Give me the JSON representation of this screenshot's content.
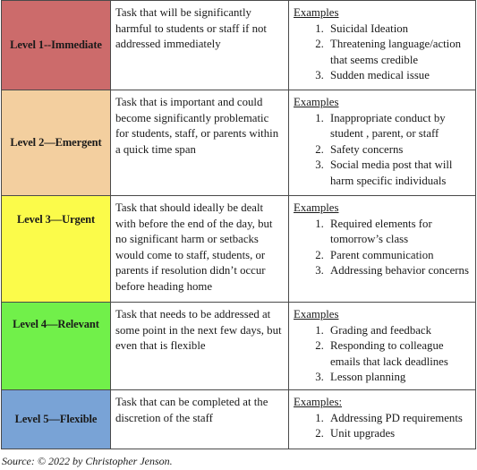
{
  "rows": [
    {
      "level": "Level 1--Immediate",
      "color": "#cc6b6b",
      "description": "Task that will be significantly harmful to students or staff if not addressed immediately",
      "examples_label": "Examples",
      "examples": [
        "Suicidal Ideation",
        "Threatening language/action that seems credible",
        "Sudden medical issue"
      ]
    },
    {
      "level": "Level 2—Emergent",
      "color": "#f3cf9f",
      "description": "Task that is important and could become significantly problematic for students, staff, or parents within a quick time span",
      "examples_label": "Examples",
      "examples": [
        "Inappropriate conduct by student , parent, or staff",
        "Safety concerns",
        "Social media post that will harm specific individuals"
      ]
    },
    {
      "level": "Level 3—Urgent",
      "color": "#fbfb4a",
      "description": "Task that should ideally be dealt with before the end of the day, but no significant harm or setbacks would come to staff, students, or parents if resolution didn’t occur before heading home",
      "examples_label": "Examples",
      "examples": [
        "Required elements for tomorrow’s class",
        "Parent communication",
        "Addressing behavior concerns"
      ]
    },
    {
      "level": "Level 4—Relevant",
      "color": "#71f04a",
      "description": "Task that needs to be addressed at some point in the next few days, but even that is flexible",
      "examples_label": "Examples",
      "examples": [
        "Grading and feedback",
        "Responding to colleague emails that lack deadlines",
        "Lesson planning"
      ]
    },
    {
      "level": "Level 5—Flexible",
      "color": "#79a3d6",
      "description": "Task that can be completed at the discretion of the staff",
      "examples_label": "Examples:",
      "examples": [
        "Addressing PD requirements",
        "Unit upgrades"
      ]
    }
  ],
  "source": "Source: © 2022 by Christopher Jenson."
}
